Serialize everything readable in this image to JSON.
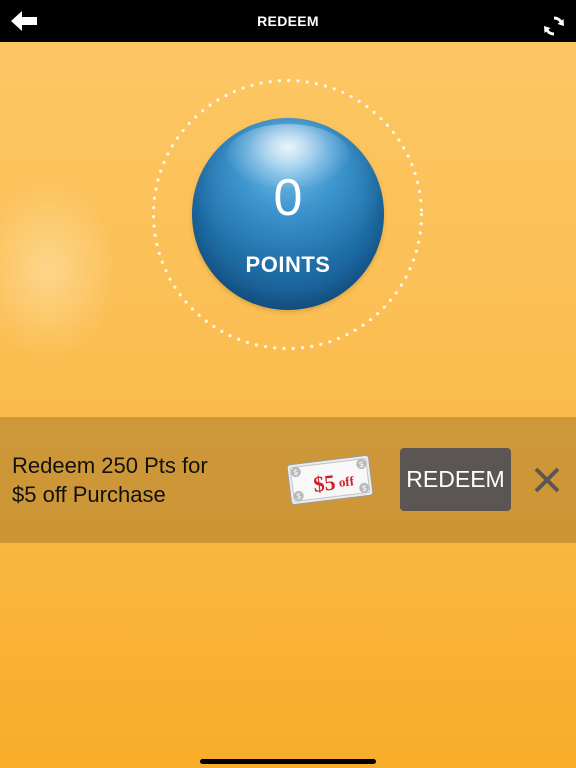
{
  "header": {
    "title": "REDEEM"
  },
  "points": {
    "value": "0",
    "label": "POINTS"
  },
  "offer": {
    "line1": "Redeem 250 Pts for",
    "line2": "$5 off Purchase",
    "coupon": {
      "amount": "$5",
      "suffix": "off",
      "corner_symbol": "$"
    },
    "redeem_label": "REDEEM"
  },
  "colors": {
    "background_top": "#fcc866",
    "background_bottom": "#f8ad2a",
    "orb_blue": "#1f6fa8",
    "button_gray": "#5b5653",
    "topbar": "#000000"
  },
  "icons": {
    "back": "back-arrow-icon",
    "refresh": "refresh-icon",
    "close": "close-icon"
  }
}
